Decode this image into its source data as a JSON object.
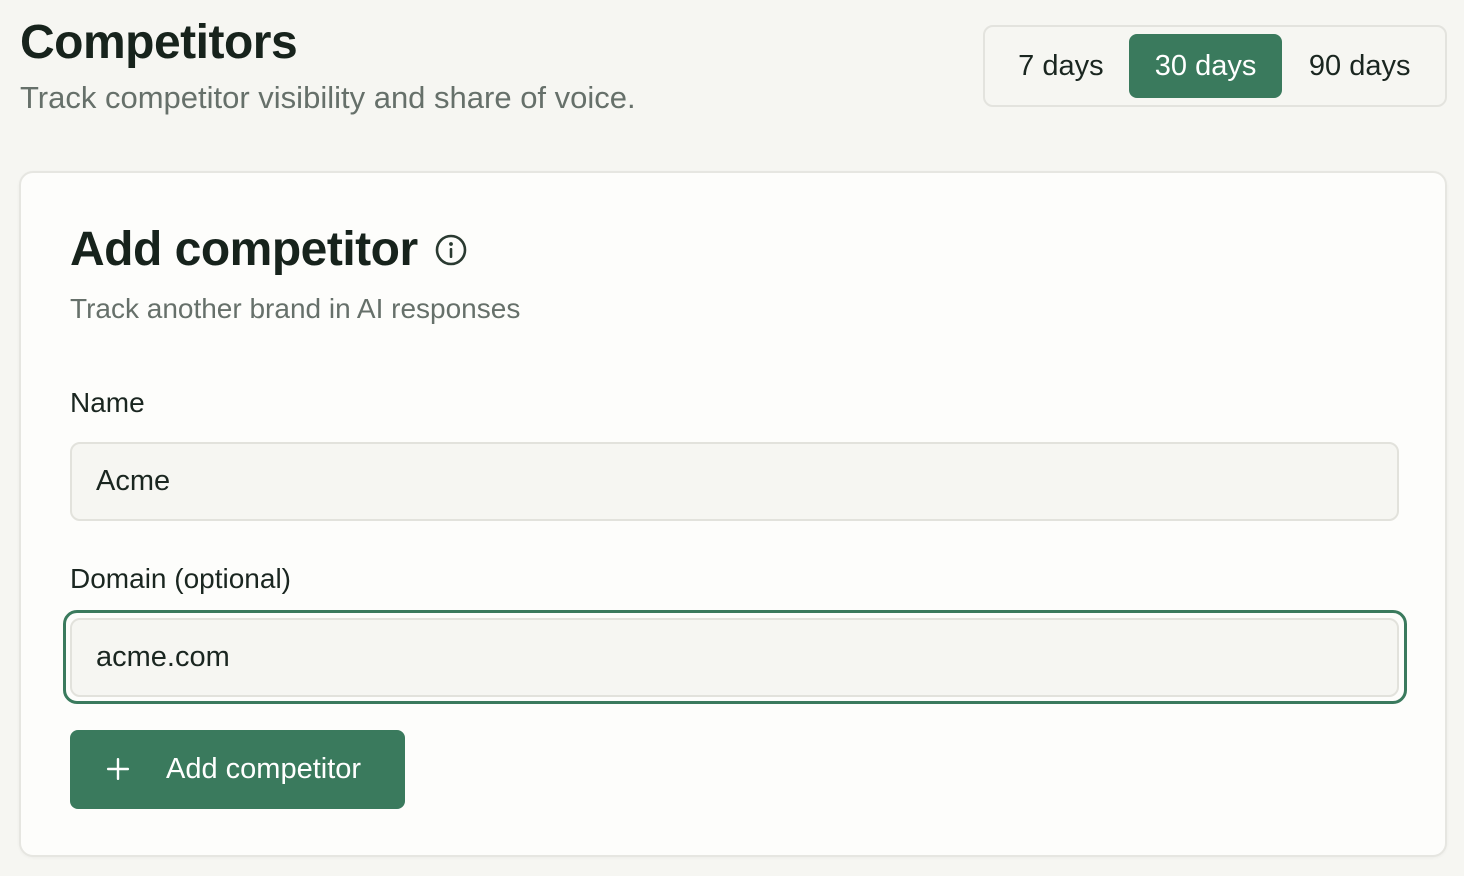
{
  "header": {
    "title": "Competitors",
    "subtitle": "Track competitor visibility and share of voice."
  },
  "range": {
    "options": [
      {
        "label": "7 days",
        "active": false
      },
      {
        "label": "30 days",
        "active": true
      },
      {
        "label": "90 days",
        "active": false
      }
    ],
    "selected": "30 days"
  },
  "card": {
    "title": "Add competitor",
    "info_icon": "info-circle-icon",
    "subtitle": "Track another brand in AI responses",
    "name_label": "Name",
    "name_value": "Acme",
    "domain_label": "Domain (optional)",
    "domain_value": "acme.com",
    "submit_label": "Add competitor",
    "submit_icon": "plus-icon"
  },
  "colors": {
    "accent": "#3a7a5d",
    "background": "#f6f6f2",
    "card": "#fdfdfb",
    "muted_text": "#66706a"
  }
}
